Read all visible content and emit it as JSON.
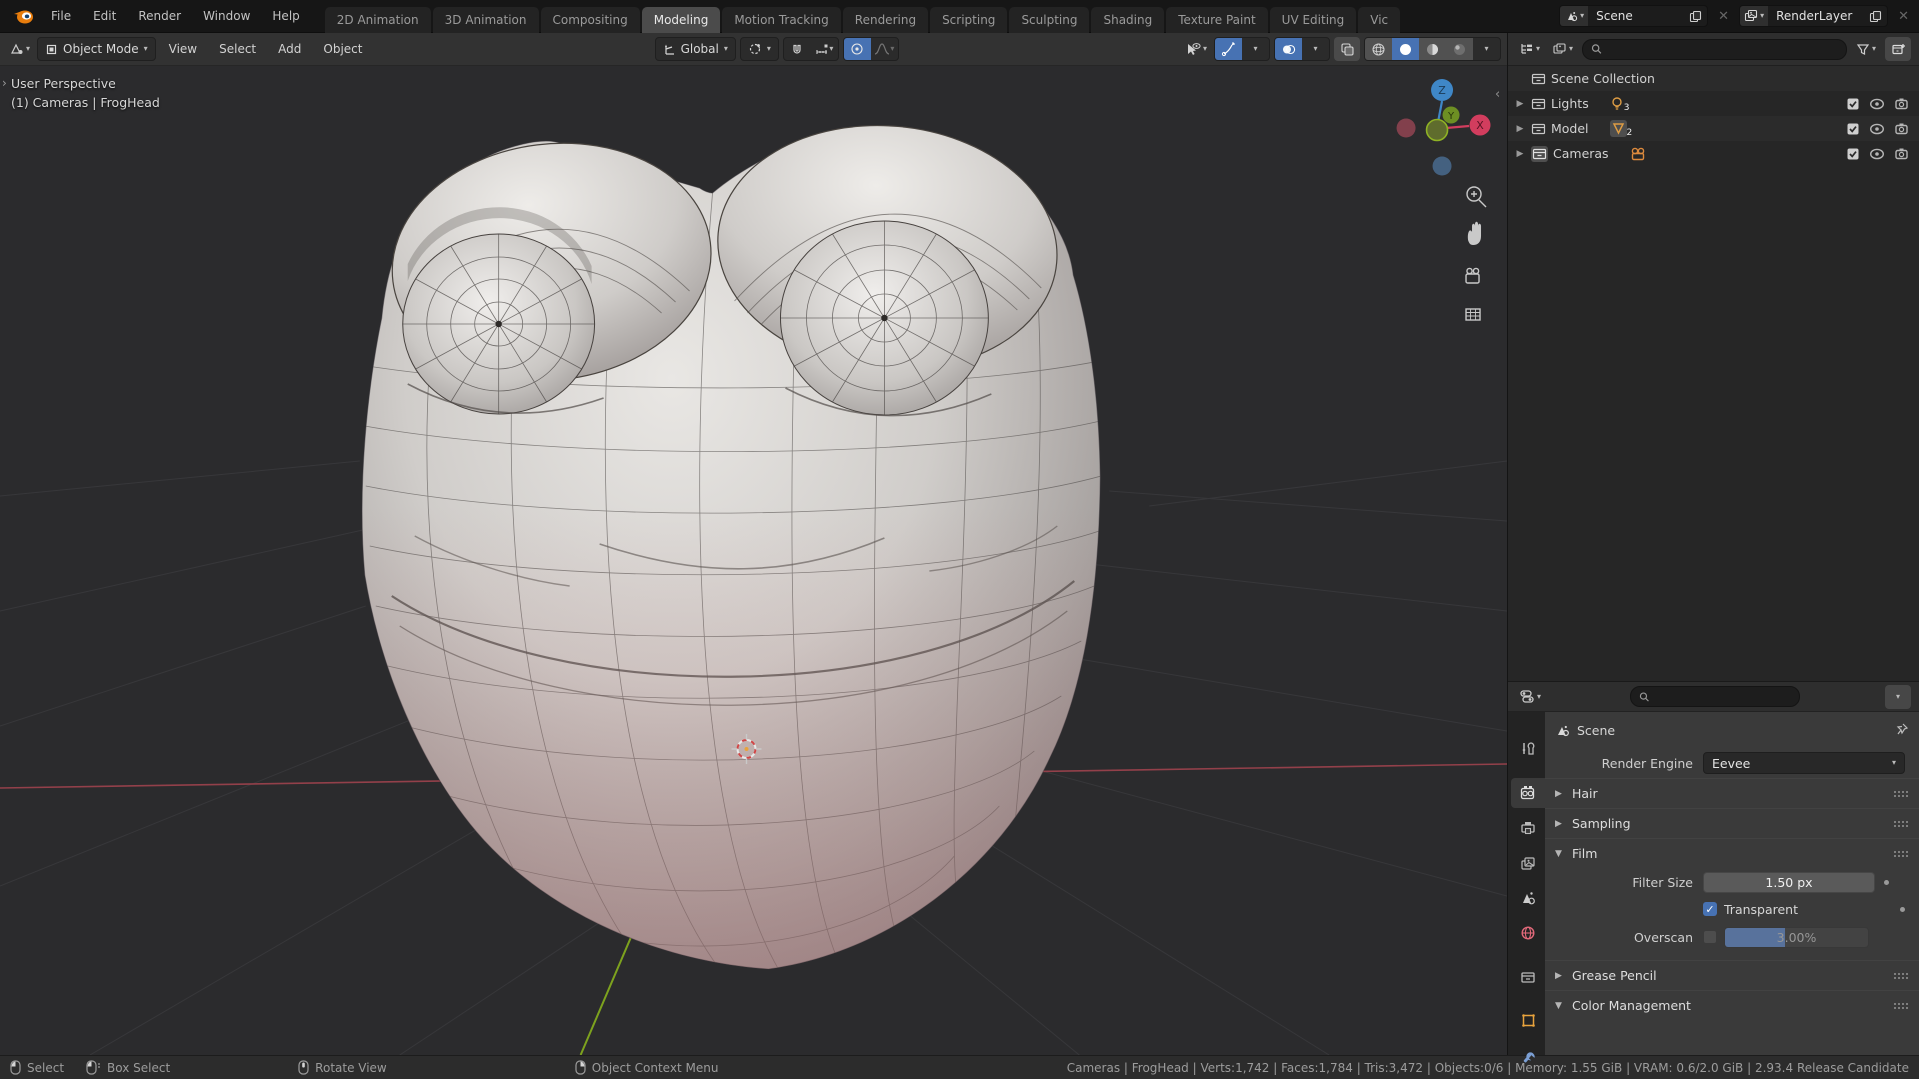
{
  "topbar": {
    "menus": [
      "File",
      "Edit",
      "Render",
      "Window",
      "Help"
    ],
    "workspaces": [
      {
        "label": "2D Animation",
        "active": false
      },
      {
        "label": "3D Animation",
        "active": false
      },
      {
        "label": "Compositing",
        "active": false
      },
      {
        "label": "Modeling",
        "active": true
      },
      {
        "label": "Motion Tracking",
        "active": false
      },
      {
        "label": "Rendering",
        "active": false
      },
      {
        "label": "Scripting",
        "active": false
      },
      {
        "label": "Sculpting",
        "active": false
      },
      {
        "label": "Shading",
        "active": false
      },
      {
        "label": "Texture Paint",
        "active": false
      },
      {
        "label": "UV Editing",
        "active": false
      },
      {
        "label": "Vic",
        "active": false
      }
    ],
    "scene": {
      "value": "Scene"
    },
    "render_layer": {
      "value": "RenderLayer"
    }
  },
  "vheader": {
    "mode": "Object Mode",
    "menus": [
      "View",
      "Select",
      "Add",
      "Object"
    ],
    "orientation": "Global"
  },
  "viewport": {
    "overlay": {
      "line1": "User Perspective",
      "line2": "(1) Cameras | FrogHead"
    },
    "gizmo": {
      "z": "Z",
      "y": "Y",
      "x": "X"
    }
  },
  "outliner": {
    "root": "Scene Collection",
    "rows": [
      {
        "label": "Lights",
        "count": "3"
      },
      {
        "label": "Model",
        "count": "2"
      },
      {
        "label": "Cameras",
        "count": ""
      }
    ]
  },
  "props": {
    "breadcrumb": "Scene",
    "engine": {
      "label": "Render Engine",
      "value": "Eevee"
    },
    "panels": {
      "hair": "Hair",
      "sampling": "Sampling",
      "film": "Film",
      "grease": "Grease Pencil",
      "color": "Color Management"
    },
    "film": {
      "filter_label": "Filter Size",
      "filter_value": "1.50 px",
      "transparent_label": "Transparent",
      "transparent_checked": "✓",
      "overscan_label": "Overscan",
      "overscan_value": "3.00%"
    }
  },
  "status": {
    "hints": [
      "Select",
      "Box Select",
      "Rotate View",
      "Object Context Menu"
    ],
    "stats": "Cameras | FrogHead | Verts:1,742 | Faces:1,784 | Tris:3,472 | Objects:0/6 | Memory: 1.55 GiB | VRAM: 0.6/2.0 GiB | 2.93.4 Release Candidate"
  },
  "colors": {
    "accent_blue": "#4772b3",
    "blender_orange": "#e87d0d",
    "axis_x_red": "#d23d5e",
    "axis_y_green": "#86b324",
    "axis_z_blue": "#3f87c7",
    "world_pink": "#e1697a"
  }
}
